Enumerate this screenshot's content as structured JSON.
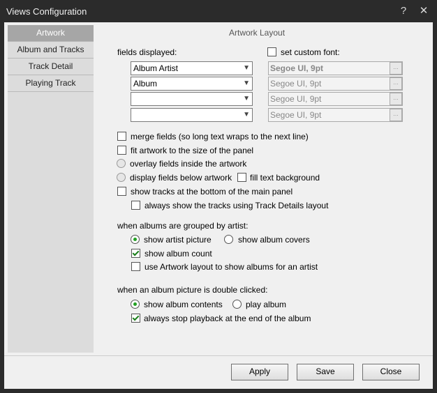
{
  "window": {
    "title": "Views Configuration",
    "help_glyph": "?",
    "close_glyph": "✕"
  },
  "sidebar": {
    "items": [
      {
        "label": "Artwork",
        "active": true
      },
      {
        "label": "Album and Tracks",
        "active": false
      },
      {
        "label": "Track Detail",
        "active": false
      },
      {
        "label": "Playing Track",
        "active": false
      }
    ]
  },
  "main": {
    "heading": "Artwork Layout",
    "fields_label": "fields displayed:",
    "custom_font_label": "set custom font:",
    "fields": [
      {
        "value": "Album Artist",
        "font": "Segoe UI, 9pt",
        "font_bold": true
      },
      {
        "value": "Album",
        "font": "Segoe UI, 9pt",
        "font_bold": false
      },
      {
        "value": "",
        "font": "Segoe UI, 9pt",
        "font_bold": false
      },
      {
        "value": "",
        "font": "Segoe UI, 9pt",
        "font_bold": false
      }
    ],
    "dots": "...",
    "options": {
      "merge_fields": "merge fields (so long text wraps to the next line)",
      "fit_artwork": "fit artwork to the size of the panel",
      "overlay_fields": "overlay fields inside the artwork",
      "display_below": "display fields below artwork",
      "fill_text_bg": "fill text background",
      "show_tracks_bottom": "show tracks at the bottom of the main panel",
      "always_track_details": "always show the tracks using Track Details layout"
    },
    "grouped_label": "when albums are grouped by artist:",
    "grouped": {
      "show_artist_picture": "show artist picture",
      "show_album_covers": "show album covers",
      "show_album_count": "show album count",
      "use_artwork_layout": "use Artwork layout to show albums for an artist"
    },
    "double_click_label": "when an album picture is double clicked:",
    "double_click": {
      "show_album_contents": "show album contents",
      "play_album": "play album",
      "always_stop": "always stop playback at the end of the album"
    }
  },
  "buttons": {
    "apply": "Apply",
    "save": "Save",
    "close": "Close"
  }
}
